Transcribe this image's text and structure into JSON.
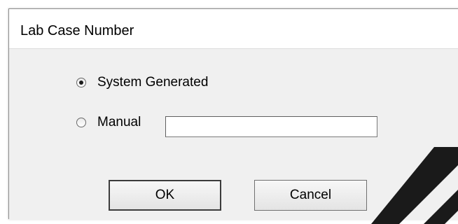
{
  "dialog": {
    "title": "Lab Case Number",
    "options": [
      {
        "label": "System Generated",
        "selected": true
      },
      {
        "label": "Manual",
        "selected": false
      }
    ],
    "manual_value": "",
    "buttons": {
      "ok": "OK",
      "cancel": "Cancel"
    }
  },
  "colors": {
    "client_background": "#f0f0f0",
    "window_background": "#ffffff",
    "watermark": "#1a1a1a"
  }
}
